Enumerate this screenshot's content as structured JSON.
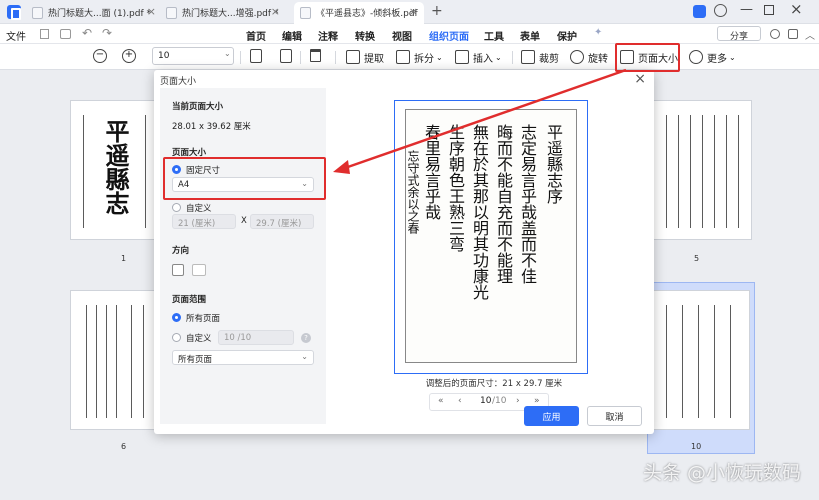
{
  "tabs": [
    {
      "label": "热门标题大...面 (1).pdf *"
    },
    {
      "label": "热门标题大...增强.pdf *"
    },
    {
      "label": "《平遥县志》-倾斜板.pdf"
    }
  ],
  "menu": {
    "file": "文件",
    "items": [
      "首页",
      "编辑",
      "注释",
      "转换",
      "视图",
      "组织页面",
      "工具",
      "表单",
      "保护"
    ],
    "share": "分享"
  },
  "toolbar": {
    "zoom_value": "10",
    "extract": "提取",
    "split": "拆分",
    "insert": "插入",
    "crop": "裁剪",
    "rotate": "旋转",
    "page_size": "页面大小",
    "more": "更多"
  },
  "thumbnails": {
    "page_labels": [
      "1",
      "5",
      "6",
      "10"
    ]
  },
  "dialog": {
    "title": "页面大小",
    "current_size_label": "当前页面大小",
    "current_size_value": "28.01 x 39.62 厘米",
    "page_size_label": "页面大小",
    "fixed_size_option": "固定尺寸",
    "fixed_size_value": "A4",
    "custom_option": "自定义",
    "custom_width_placeholder": "21 (厘米)",
    "custom_x": "X",
    "custom_height_placeholder": "29.7 (厘米)",
    "orientation_label": "方向",
    "range_label": "页面范围",
    "all_pages_option": "所有页面",
    "custom_range_option": "自定义",
    "custom_range_value": "10 /10",
    "range_select_value": "所有页面",
    "adjusted_size_note": "调整后的页面尺寸：21 x 29.7 厘米",
    "page_current": "10",
    "page_total": "/10",
    "apply": "应用",
    "cancel": "取消"
  },
  "preview_columns": [
    "平遥縣志序",
    "志定易言乎哉盖而不佳",
    "晦而不能自充而不能理",
    "無在於其那以明其功康光",
    "生序朝色王熟三弯",
    "春里易言乎哉",
    "忘守式余以之春"
  ],
  "thumb1_title": [
    "平",
    "遥",
    "縣",
    "志"
  ],
  "watermark": "头条 @小恢玩数码",
  "colors": {
    "accent": "#2d6df6",
    "highlight": "#e02d2d"
  }
}
